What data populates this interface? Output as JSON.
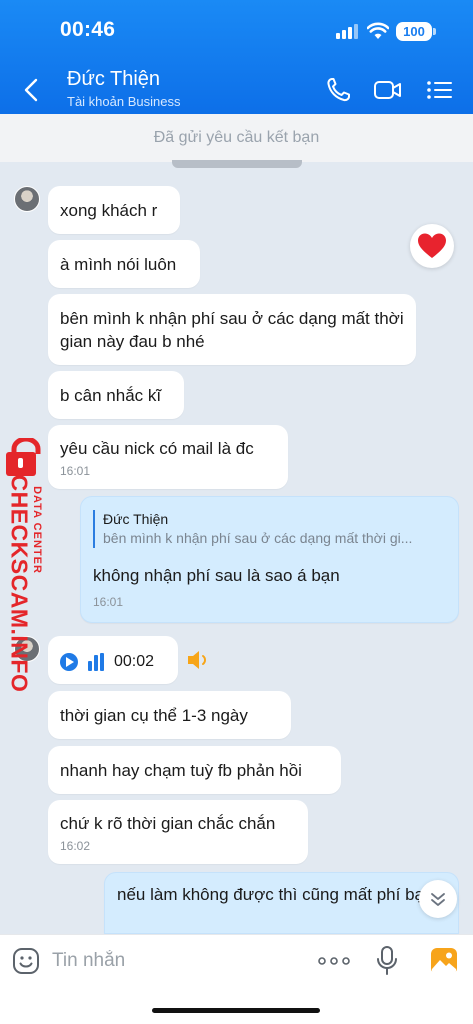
{
  "status_bar": {
    "time": "00:46",
    "battery": "100"
  },
  "header": {
    "contact_name": "Đức Thiện",
    "contact_subtitle": "Tài khoản Business"
  },
  "friend_request": {
    "text": "Đã gửi yêu cầu kết bạn"
  },
  "messages": [
    {
      "text": "xong khách r"
    },
    {
      "text": "à mình nói luôn"
    },
    {
      "text": "bên mình k nhận phí sau ở các dạng mất thời gian này đau b nhé"
    },
    {
      "text": "b cân nhắc kĩ"
    },
    {
      "text": "yêu cầu nick có mail là đc",
      "time": "16:01"
    },
    {
      "reply_to_name": "Đức Thiện",
      "reply_to_text": "bên mình k nhận phí sau ở các dạng mất thời gi...",
      "text": "không nhận phí sau là sao á bạn",
      "time": "16:01"
    },
    {
      "voice_duration": "00:02"
    },
    {
      "text": "thời gian cụ thể 1-3 ngày"
    },
    {
      "text": "nhanh hay chạm tuỳ fb phản hồi"
    },
    {
      "text": "chứ k rõ thời gian chắc chắn",
      "time": "16:02"
    },
    {
      "text": "nếu làm không được thì cũng mất phí bạn"
    }
  ],
  "watermark": {
    "brand": "CHECKSCAM.INFO",
    "tag": "DATA CENTER"
  },
  "input": {
    "placeholder": "Tin nhắn"
  },
  "colors": {
    "header": "#0d6fe8",
    "my_bubble": "#d4ecfe",
    "accent": "#1f7ae6",
    "watermark": "#e4262a"
  },
  "icons": [
    "back-icon",
    "phone-icon",
    "video-call-icon",
    "menu-list-icon",
    "heart-icon",
    "chevron-down-icon",
    "emoji-icon",
    "more-icon",
    "mic-icon",
    "image-icon",
    "play-icon",
    "speaker-icon",
    "lock-icon"
  ]
}
